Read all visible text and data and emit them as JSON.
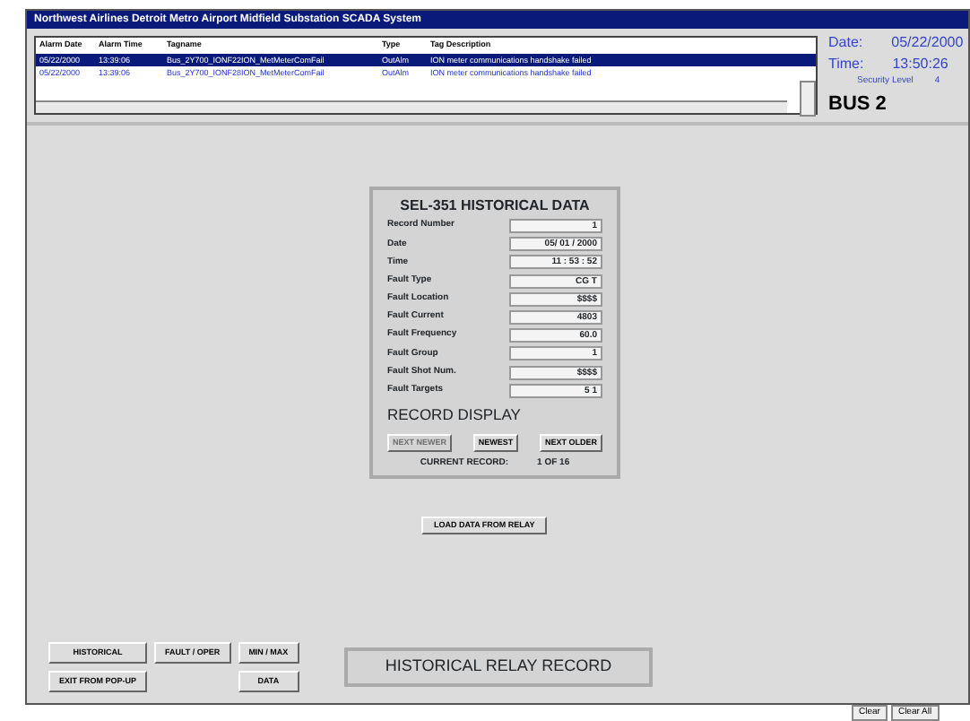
{
  "window": {
    "title": "Northwest Airlines Detroit Metro Airport Midfield Substation SCADA System"
  },
  "alarms": {
    "columns": [
      "Alarm Date",
      "Alarm Time",
      "Tagname",
      "Type",
      "Tag Description"
    ],
    "rows": [
      {
        "selected": true,
        "cells": [
          "05/22/2000",
          "13:39:06",
          "Bus_2Y700_IONF22ION_MetMeterComFail",
          "OutAlm",
          "ION meter communications handshake failed"
        ]
      },
      {
        "selected": false,
        "cells": [
          "05/22/2000",
          "13:39:06",
          "Bus_2Y700_IONF28ION_MetMeterComFail",
          "OutAlm",
          "ION meter communications handshake failed"
        ]
      }
    ]
  },
  "status": {
    "date_label": "Date:",
    "date": "05/22/2000",
    "time_label": "Time:",
    "time": "13:50:26",
    "security_label": "Security Level",
    "security": "4",
    "bus": "BUS 2"
  },
  "panel": {
    "title": "SEL-351 HISTORICAL DATA",
    "fields": [
      {
        "label": "Record Number",
        "value": "1"
      },
      {
        "label": "Date",
        "value": "05/ 01 / 2000"
      },
      {
        "label": "Time",
        "value": "11 : 53 : 52"
      },
      {
        "label": "Fault Type",
        "value": "CG  T"
      },
      {
        "label": "Fault Location",
        "value": "$$$$"
      },
      {
        "label": "Fault Current",
        "value": "4803"
      },
      {
        "label": "Fault Frequency",
        "value": "60.0"
      },
      {
        "label": "Fault Group",
        "value": "1"
      },
      {
        "label": "Fault Shot Num.",
        "value": "$$$$"
      },
      {
        "label": "Fault Targets",
        "value": "5 1"
      }
    ],
    "section": "RECORD DISPLAY",
    "buttons": [
      {
        "label": "NEXT NEWER",
        "disabled": true
      },
      {
        "label": "NEWEST",
        "disabled": false
      },
      {
        "label": "NEXT OLDER",
        "disabled": false
      }
    ],
    "current_label": "CURRENT RECORD:",
    "current": "1 OF 16"
  },
  "load_button": "LOAD DATA FROM RELAY",
  "nav_buttons": [
    [
      "HISTORICAL",
      "FAULT / OPER",
      "MIN / MAX"
    ],
    [
      "EXIT FROM POP-UP",
      "DATA"
    ]
  ],
  "screen_label": "HISTORICAL RELAY RECORD",
  "footer_buttons": [
    "Clear",
    "Clear All"
  ]
}
